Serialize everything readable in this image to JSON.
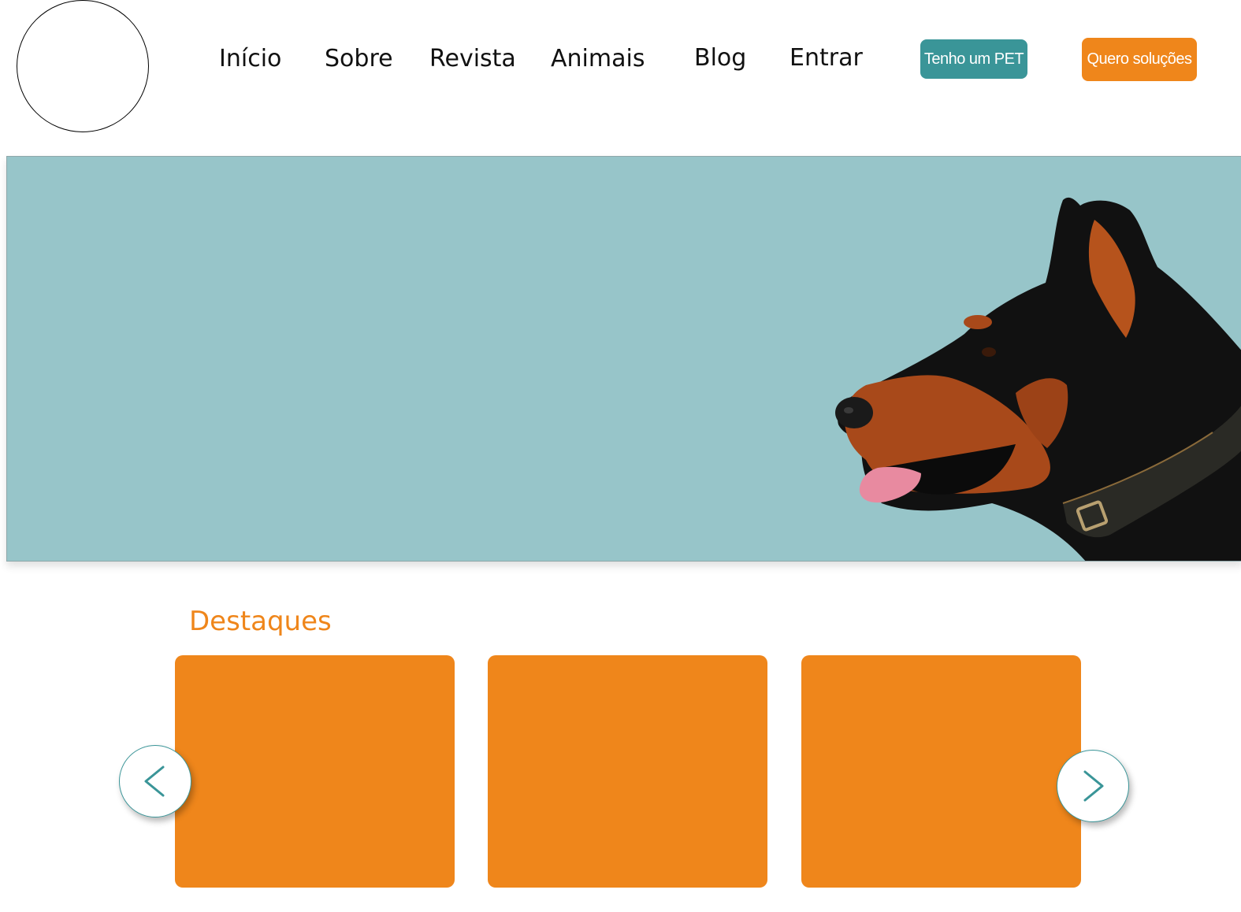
{
  "header": {
    "nav": [
      {
        "label": "Início"
      },
      {
        "label": "Sobre"
      },
      {
        "label": "Revista"
      },
      {
        "label": "Animais"
      },
      {
        "label": "Blog"
      },
      {
        "label": "Entrar"
      }
    ],
    "buttons": {
      "pet_owner": "Tenho um PET",
      "solutions": "Quero soluções"
    }
  },
  "hero": {
    "image": "doberman-dog-photo"
  },
  "highlights": {
    "title": "Destaques",
    "cards": [
      {},
      {},
      {}
    ]
  },
  "colors": {
    "accent_teal": "#3A9598",
    "accent_orange": "#EF861B",
    "hero_background": "#97C5C9"
  },
  "icons": {
    "prev": "chevron-left-icon",
    "next": "chevron-right-icon"
  }
}
